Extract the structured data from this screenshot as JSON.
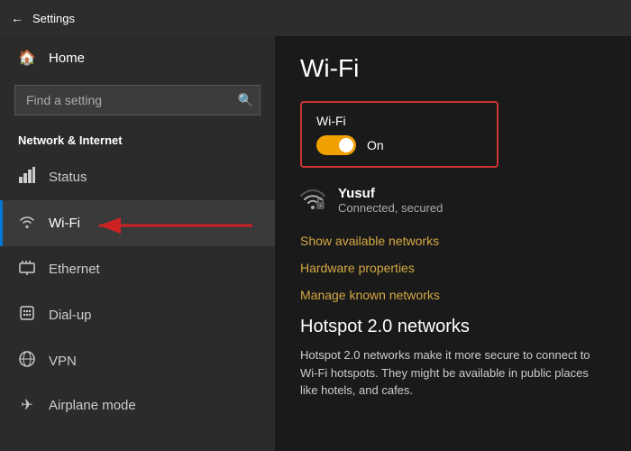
{
  "titlebar": {
    "back_label": "←",
    "title": "Settings"
  },
  "sidebar": {
    "home_label": "Home",
    "search_placeholder": "Find a setting",
    "search_icon": "🔍",
    "section_heading": "Network & Internet",
    "nav_items": [
      {
        "id": "status",
        "label": "Status",
        "icon": "🖥"
      },
      {
        "id": "wifi",
        "label": "Wi-Fi",
        "icon": "📶",
        "active": true
      },
      {
        "id": "ethernet",
        "label": "Ethernet",
        "icon": "🔌"
      },
      {
        "id": "dialup",
        "label": "Dial-up",
        "icon": "📞"
      },
      {
        "id": "vpn",
        "label": "VPN",
        "icon": "🔒"
      },
      {
        "id": "airplane",
        "label": "Airplane mode",
        "icon": "✈"
      }
    ]
  },
  "main": {
    "title": "Wi-Fi",
    "wifi_section": {
      "label": "Wi-Fi",
      "toggle_state": "On"
    },
    "connected_network": {
      "name": "Yusuf",
      "status": "Connected, secured"
    },
    "links": [
      "Show available networks",
      "Hardware properties",
      "Manage known networks"
    ],
    "hotspot_title": "Hotspot 2.0 networks",
    "hotspot_desc": "Hotspot 2.0 networks make it more secure to connect to Wi-Fi hotspots. They might be available in public places like hotels, and cafes."
  }
}
